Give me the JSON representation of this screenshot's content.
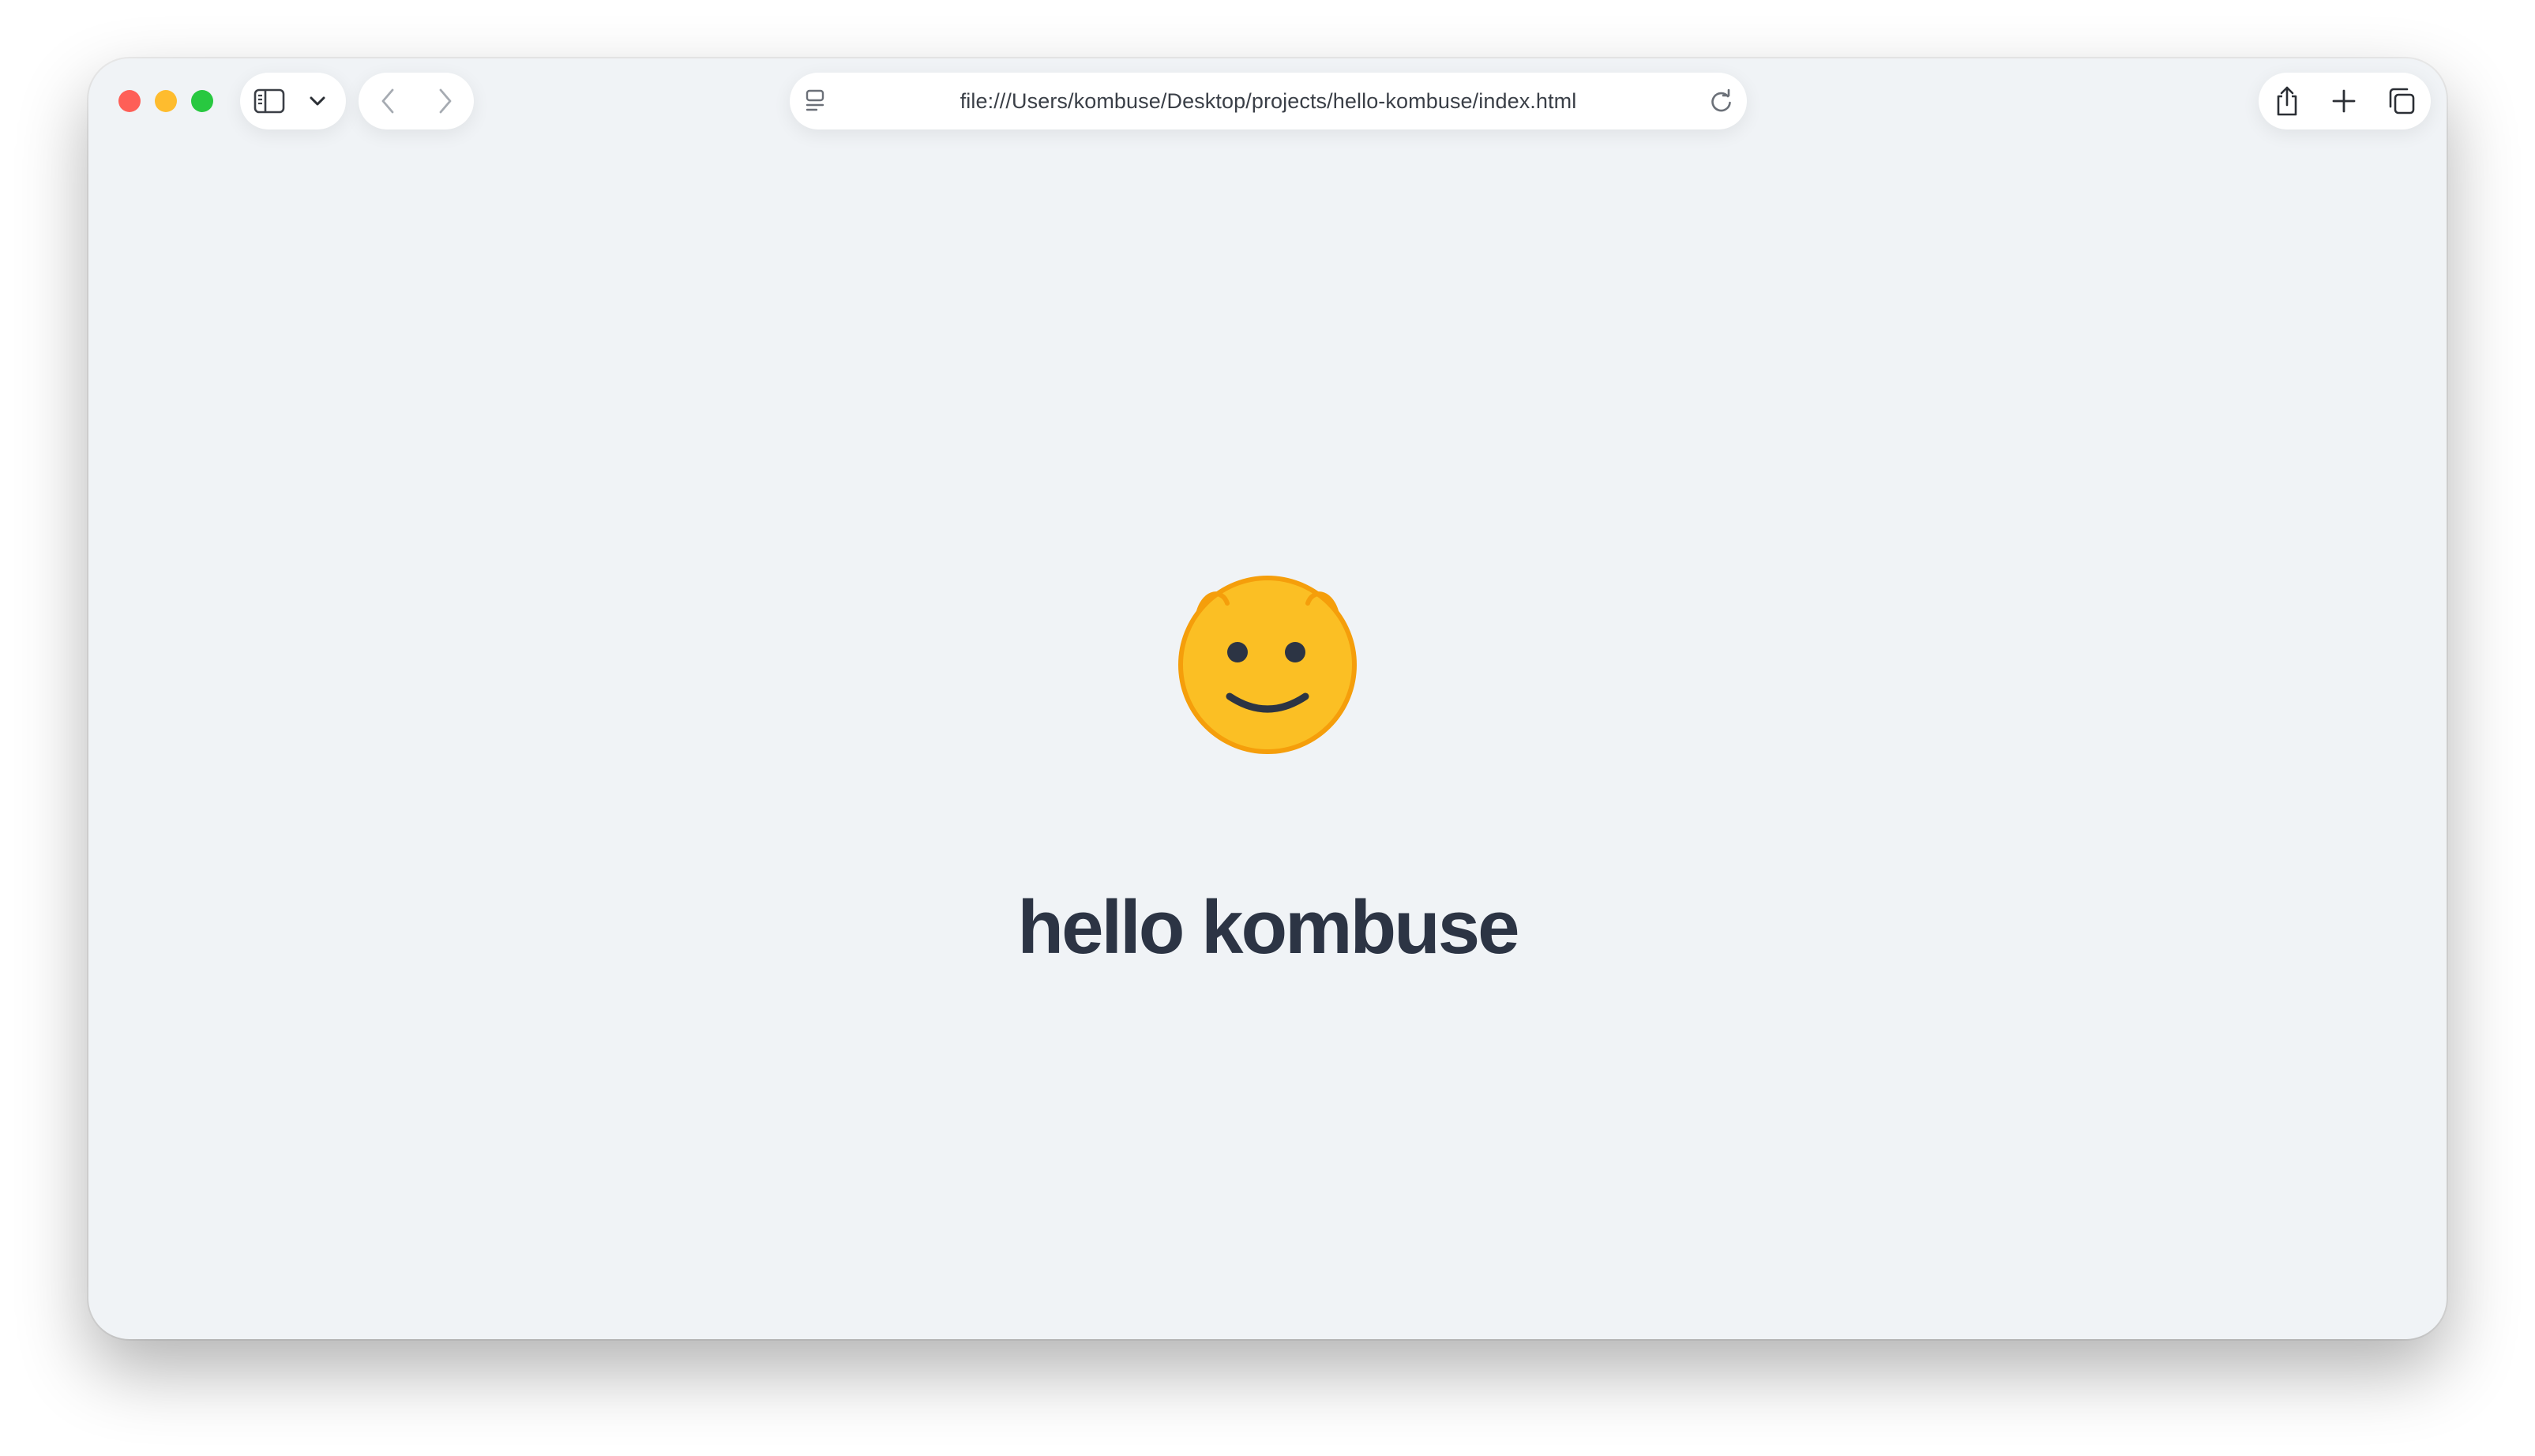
{
  "browser": {
    "address_bar": {
      "url": "file:///Users/kombuse/Desktop/projects/hello-kombuse/index.html"
    },
    "toolbar_icons": {
      "sidebar": "sidebar-icon",
      "tab_group_menu": "chevron-down-icon",
      "back": "chevron-left-icon",
      "forward": "chevron-right-icon",
      "page_menu": "page-menu-icon",
      "reload": "reload-icon",
      "share": "share-icon",
      "new_tab": "plus-icon",
      "tab_overview": "tab-overview-icon"
    },
    "window_controls": {
      "close_color": "#fe5f57",
      "minimize_color": "#febc2e",
      "maximize_color": "#28c840"
    }
  },
  "page": {
    "emoji": "smiley-face-icon",
    "heading": "hello kombuse",
    "background_color": "#f0f3f6",
    "heading_color": "#2c3444",
    "emoji_fill": "#fbbf24",
    "emoji_stroke": "#f59e0b"
  }
}
